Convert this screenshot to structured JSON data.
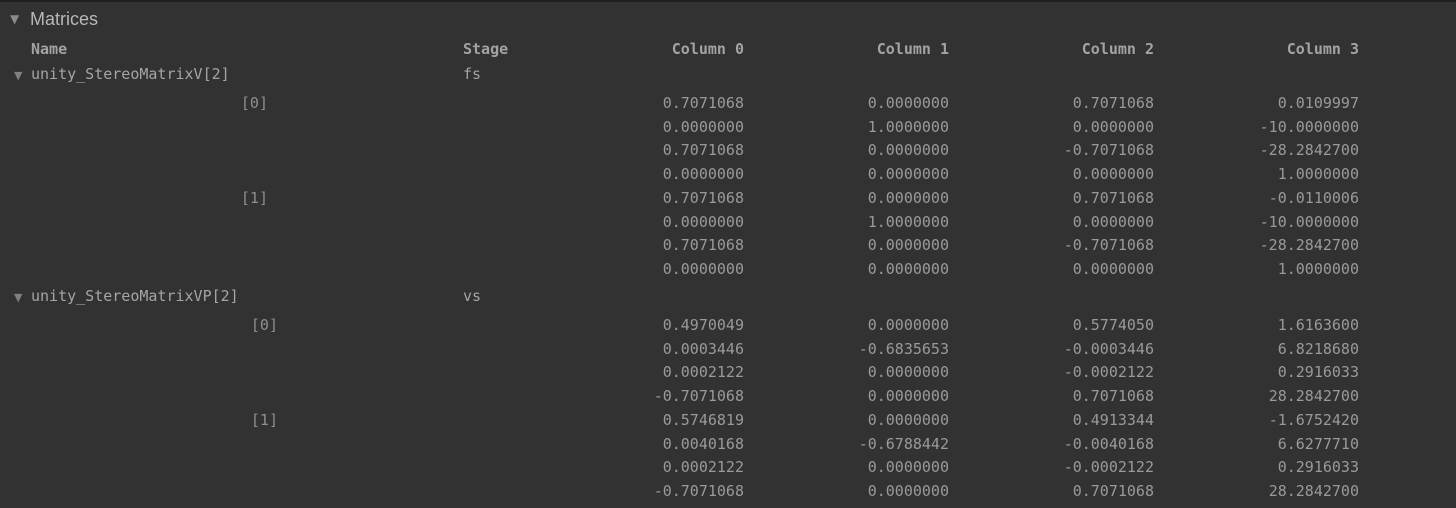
{
  "section": {
    "title": "Matrices"
  },
  "columns": {
    "name": "Name",
    "stage": "Stage",
    "col0": "Column 0",
    "col1": "Column 1",
    "col2": "Column 2",
    "col3": "Column 3"
  },
  "variables": [
    {
      "name": "unity_StereoMatrixV[2]",
      "stage": "fs",
      "elements": [
        {
          "index": "[0]",
          "rows": [
            [
              "0.7071068",
              "0.0000000",
              "0.7071068",
              "0.0109997"
            ],
            [
              "0.0000000",
              "1.0000000",
              "0.0000000",
              "-10.0000000"
            ],
            [
              "0.7071068",
              "0.0000000",
              "-0.7071068",
              "-28.2842700"
            ],
            [
              "0.0000000",
              "0.0000000",
              "0.0000000",
              "1.0000000"
            ]
          ]
        },
        {
          "index": "[1]",
          "rows": [
            [
              "0.7071068",
              "0.0000000",
              "0.7071068",
              "-0.0110006"
            ],
            [
              "0.0000000",
              "1.0000000",
              "0.0000000",
              "-10.0000000"
            ],
            [
              "0.7071068",
              "0.0000000",
              "-0.7071068",
              "-28.2842700"
            ],
            [
              "0.0000000",
              "0.0000000",
              "0.0000000",
              "1.0000000"
            ]
          ]
        }
      ]
    },
    {
      "name": "unity_StereoMatrixVP[2]",
      "stage": "vs",
      "elements": [
        {
          "index": "[0]",
          "rows": [
            [
              "0.4970049",
              "0.0000000",
              "0.5774050",
              "1.6163600"
            ],
            [
              "0.0003446",
              "-0.6835653",
              "-0.0003446",
              "6.8218680"
            ],
            [
              "0.0002122",
              "0.0000000",
              "-0.0002122",
              "0.2916033"
            ],
            [
              "-0.7071068",
              "0.0000000",
              "0.7071068",
              "28.2842700"
            ]
          ]
        },
        {
          "index": "[1]",
          "rows": [
            [
              "0.5746819",
              "0.0000000",
              "0.4913344",
              "-1.6752420"
            ],
            [
              "0.0040168",
              "-0.6788442",
              "-0.0040168",
              "6.6277710"
            ],
            [
              "0.0002122",
              "0.0000000",
              "-0.0002122",
              "0.2916033"
            ],
            [
              "-0.7071068",
              "0.0000000",
              "0.7071068",
              "28.2842700"
            ]
          ]
        }
      ]
    }
  ]
}
